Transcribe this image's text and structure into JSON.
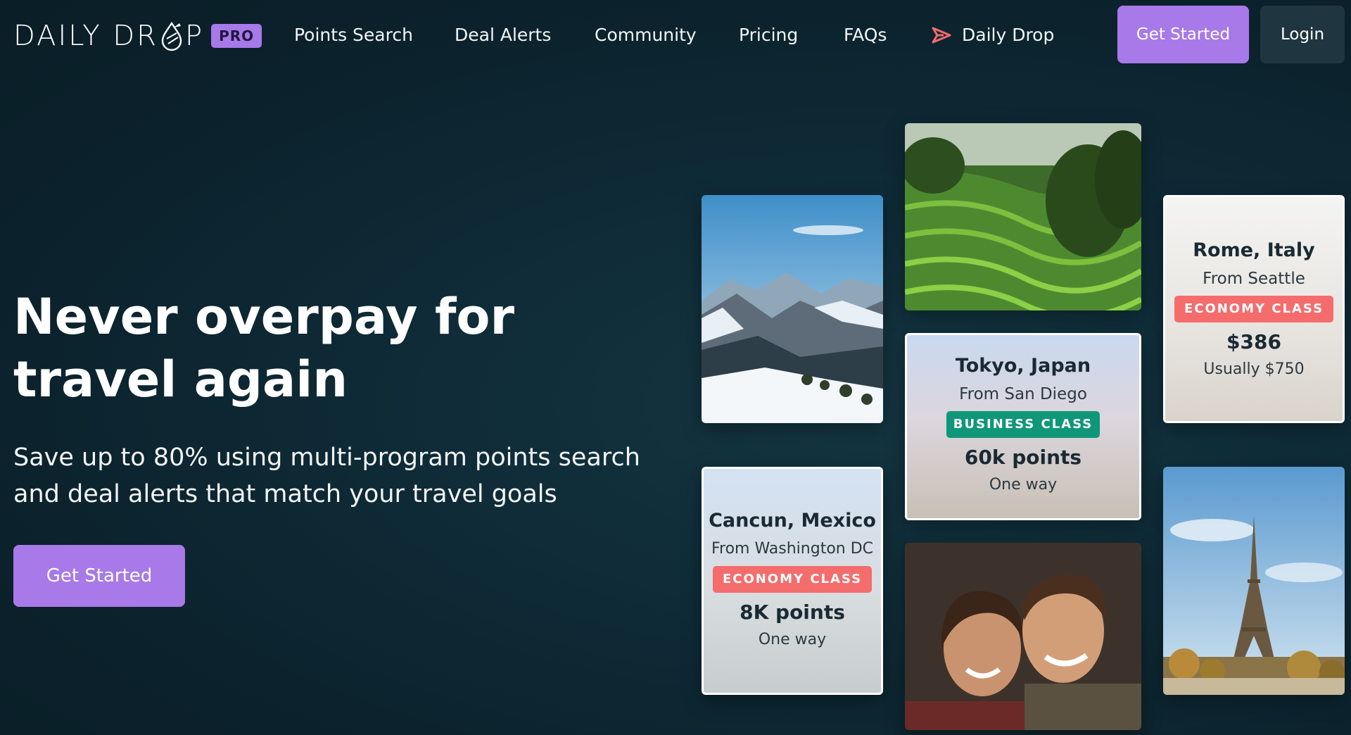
{
  "brand": {
    "name_part1": "DAILY DR",
    "name_part2": "P",
    "badge": "PRO",
    "drop_icon": "drop-logo-icon",
    "accent": "#a879e8"
  },
  "nav": {
    "links": [
      "Points Search",
      "Deal Alerts",
      "Community",
      "Pricing",
      "FAQs"
    ],
    "daily_drop": "Daily Drop",
    "daily_drop_icon": "send-arrow-icon",
    "get_started": "Get Started",
    "login": "Login"
  },
  "hero": {
    "title": "Never overpay for travel again",
    "subtitle": "Save up to 80% using multi-program points search and deal alerts that match your travel goals",
    "cta": "Get Started"
  },
  "deals": {
    "rome": {
      "city": "Rome, Italy",
      "from": "From Seattle",
      "class": "ECONOMY CLASS",
      "price": "$386",
      "note": "Usually $750"
    },
    "tokyo": {
      "city": "Tokyo, Japan",
      "from": "From San Diego",
      "class": "BUSINESS CLASS",
      "price": "60k points",
      "note": "One way"
    },
    "cancun": {
      "city": "Cancun, Mexico",
      "from": "From Washington DC",
      "class": "ECONOMY CLASS",
      "price": "8K points",
      "note": "One way"
    }
  },
  "photos": [
    "snowy-mountain-valley",
    "rice-terraces",
    "smiling-couple",
    "eiffel-tower"
  ],
  "colors": {
    "background": "#0d2631",
    "economy_badge": "#f56c6c",
    "business_badge": "#109679",
    "login_button": "#1f3540"
  }
}
